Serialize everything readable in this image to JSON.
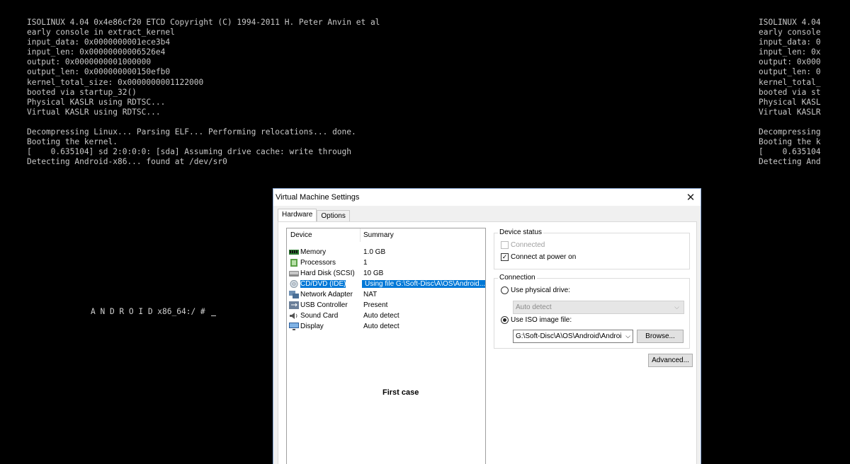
{
  "console_left": [
    "ISOLINUX 4.04 0x4e86cf20 ETCD Copyright (C) 1994-2011 H. Peter Anvin et al",
    "early console in extract_kernel",
    "input_data: 0x0000000001ece3b4",
    "input_len: 0x00000000006526e4",
    "output: 0x0000000001000000",
    "output_len: 0x000000000150efb0",
    "kernel_total_size: 0x0000000001122000",
    "booted via startup_32()",
    "Physical KASLR using RDTSC...",
    "Virtual KASLR using RDTSC...",
    "",
    "Decompressing Linux... Parsing ELF... Performing relocations... done.",
    "Booting the kernel.",
    "[    0.635104] sd 2:0:0:0: [sda] Assuming drive cache: write through",
    "Detecting Android-x86... found at /dev/sr0"
  ],
  "console_right": [
    "ISOLINUX 4.04",
    "early console",
    "input_data: 0",
    "input_len: 0x",
    "output: 0x000",
    "output_len: 0",
    "kernel_total_",
    "booted via st",
    "Physical KASL",
    "Virtual KASLR",
    "",
    "Decompressing",
    "Booting the k",
    "[    0.635104",
    "Detecting And"
  ],
  "prompt": "A N D R O I D x86_64:/ #",
  "dialog": {
    "title": "Virtual Machine Settings",
    "close_glyph": "✕",
    "tabs": {
      "hardware": "Hardware",
      "options": "Options"
    },
    "list": {
      "header_device": "Device",
      "header_summary": "Summary",
      "rows": [
        {
          "name": "Memory",
          "summary": "1.0 GB",
          "icon": "memory-icon"
        },
        {
          "name": "Processors",
          "summary": "1",
          "icon": "processor-icon"
        },
        {
          "name": "Hard Disk (SCSI)",
          "summary": "10 GB",
          "icon": "hard-disk-icon"
        },
        {
          "name": "CD/DVD (IDE)",
          "summary": "Using file G:\\Soft-Disc\\A\\OS\\Android...",
          "icon": "cd-dvd-icon",
          "selected": true
        },
        {
          "name": "Network Adapter",
          "summary": "NAT",
          "icon": "network-adapter-icon"
        },
        {
          "name": "USB Controller",
          "summary": "Present",
          "icon": "usb-icon"
        },
        {
          "name": "Sound Card",
          "summary": "Auto detect",
          "icon": "sound-card-icon"
        },
        {
          "name": "Display",
          "summary": "Auto detect",
          "icon": "display-icon"
        }
      ],
      "annotation": "First case"
    },
    "device_status": {
      "title": "Device status",
      "connected_label": "Connected",
      "connected_checked": false,
      "connect_power_label": "Connect at power on",
      "connect_power_checked": true
    },
    "connection": {
      "title": "Connection",
      "physical_label": "Use physical drive:",
      "physical_selected": false,
      "physical_value": "Auto detect",
      "iso_label": "Use ISO image file:",
      "iso_selected": true,
      "iso_path": "G:\\Soft-Disc\\A\\OS\\Android\\Androic",
      "browse_label": "Browse..."
    },
    "advanced_label": "Advanced...",
    "colors": {
      "selection": "#0078d7",
      "console_text": "#c8c8c8"
    }
  }
}
